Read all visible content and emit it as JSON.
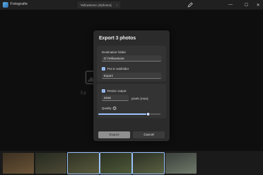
{
  "app": {
    "title": "Fotografie"
  },
  "topbar": {
    "folder": "Yellowstone (3/photos)"
  },
  "viewer": {
    "placeholder_text": "3 p"
  },
  "dialog": {
    "title": "Export 3 photos",
    "destination": {
      "label": "Destination folder",
      "value": "D:\\Yellowstone"
    },
    "subfolder": {
      "label": "Put in subfolder",
      "checked": true,
      "value": "Export"
    },
    "resize": {
      "label": "Resize output",
      "checked": true,
      "value": "2048",
      "unit": "pixels (max)"
    },
    "quality": {
      "label": "Quality",
      "info": "?",
      "value_fraction": 0.8
    },
    "buttons": {
      "export": "Export",
      "cancel": "Cancel"
    }
  },
  "filmstrip": {
    "thumbnails": [
      {
        "name": "thumb-1",
        "colors": [
          "#3b3022",
          "#6b5436"
        ]
      },
      {
        "name": "thumb-2",
        "colors": [
          "#252a20",
          "#4e4a36"
        ]
      },
      {
        "name": "thumb-3",
        "colors": [
          "#2e3224",
          "#5a5a3d"
        ]
      },
      {
        "name": "thumb-4",
        "colors": [
          "#2a3022",
          "#4f5a38"
        ]
      },
      {
        "name": "thumb-5",
        "colors": [
          "#2a2f24",
          "#5a6242"
        ]
      },
      {
        "name": "thumb-6",
        "colors": [
          "#3a3f3b",
          "#707a6a"
        ]
      }
    ]
  }
}
